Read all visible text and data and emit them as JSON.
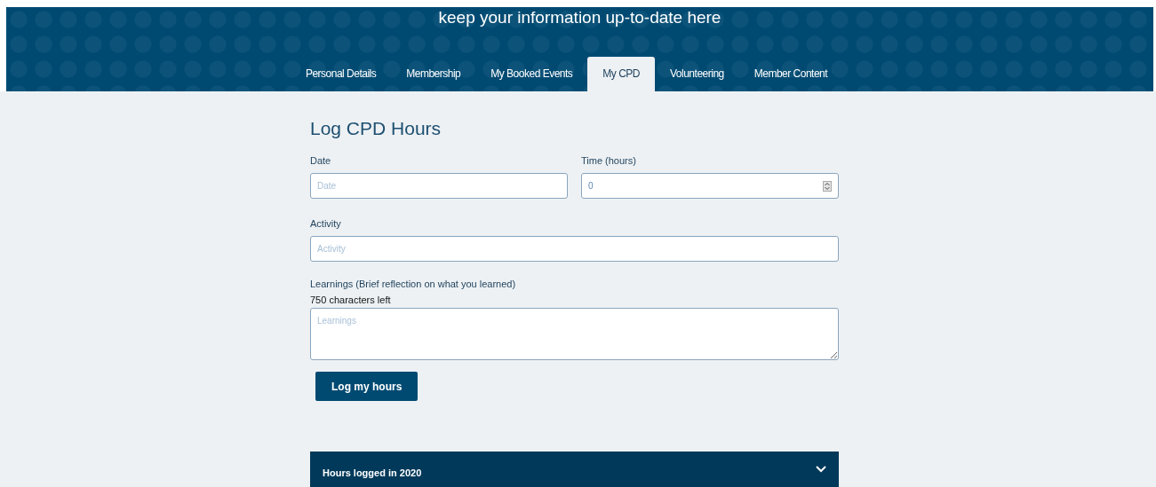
{
  "header": {
    "subtitle": "keep your information up-to-date here"
  },
  "tabs": [
    {
      "label": "Personal Details",
      "selected": false
    },
    {
      "label": "Membership",
      "selected": false
    },
    {
      "label": "My Booked Events",
      "selected": false
    },
    {
      "label": "My CPD",
      "selected": true
    },
    {
      "label": "Volunteering",
      "selected": false
    },
    {
      "label": "Member Content",
      "selected": false
    }
  ],
  "form": {
    "title": "Log CPD Hours",
    "date": {
      "label": "Date",
      "placeholder": "Date"
    },
    "time": {
      "label": "Time (hours)",
      "value": "0"
    },
    "activity": {
      "label": "Activity",
      "placeholder": "Activity"
    },
    "learnings": {
      "label": "Learnings (Brief reflection on what you learned)",
      "counter": "750 characters left",
      "placeholder": "Learnings"
    },
    "submit": "Log my hours"
  },
  "accordion": {
    "title": "Hours logged in 2020",
    "expanded": false
  }
}
